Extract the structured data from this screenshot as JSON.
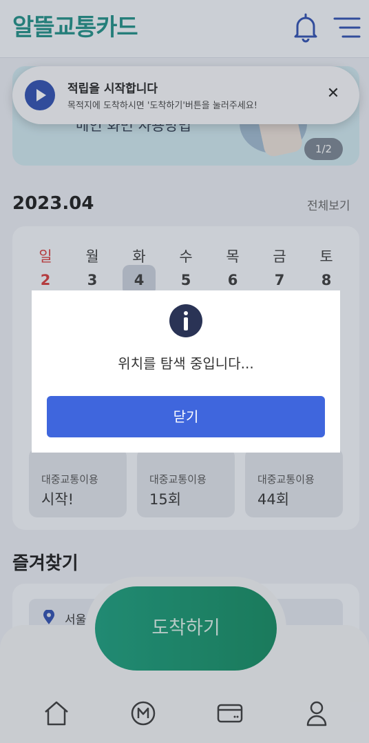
{
  "header": {
    "logo": "알뜰교통카드",
    "icons": {
      "bell": "bell-icon",
      "menu": "hamburger-menu-icon"
    }
  },
  "banner": {
    "text": "메인 화면 사용방법",
    "page_indicator": "1/2"
  },
  "toast": {
    "title": "적립을 시작합니다",
    "subtitle": "목적지에 도착하시면 '도착하기'버튼을 눌러주세요!",
    "close_label": "✕"
  },
  "calendar": {
    "month": "2023.04",
    "view_all": "전체보기",
    "weekdays": [
      "일",
      "월",
      "화",
      "수",
      "목",
      "금",
      "토"
    ],
    "days": [
      "2",
      "3",
      "4",
      "5",
      "6",
      "7",
      "8"
    ],
    "today_index": 2
  },
  "stats": [
    {
      "label": "대중교통이용",
      "value": "시작!"
    },
    {
      "label": "대중교통이용",
      "value": "15회"
    },
    {
      "label": "대중교통이용",
      "value": "44회"
    }
  ],
  "favorites": {
    "title": "즐겨찾기",
    "items": [
      "서울"
    ]
  },
  "fab": {
    "label": "도착하기"
  },
  "bottom_nav": {
    "icons": [
      "home-icon",
      "mileage-icon",
      "card-icon",
      "profile-icon"
    ]
  },
  "dialog": {
    "message": "위치를 탐색 중입니다...",
    "button": "닫기"
  },
  "colors": {
    "brand": "#1f8f86",
    "accent_blue": "#3f66dd",
    "fab_green": "#128a5f",
    "sunday_red": "#d63a3a"
  }
}
